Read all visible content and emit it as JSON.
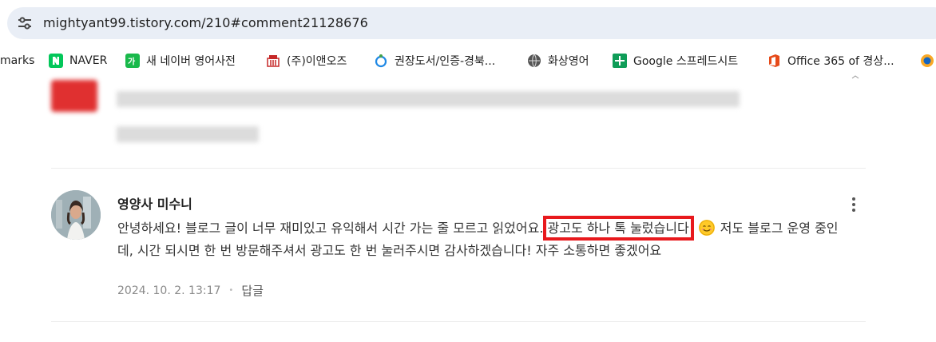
{
  "browser": {
    "url": "mightyant99.tistory.com/210#comment21128676"
  },
  "bookmarks": [
    {
      "label": "marks",
      "icon": "bookmarks-icon"
    },
    {
      "label": "NAVER",
      "icon": "naver-icon"
    },
    {
      "label": "새 네이버 영어사전",
      "icon": "naver-dictionary-icon"
    },
    {
      "label": "(주)이앤오즈",
      "icon": "eanoz-icon"
    },
    {
      "label": "권장도서/인증-경북...",
      "icon": "book-cert-icon"
    },
    {
      "label": "화상영어",
      "icon": "video-english-icon"
    },
    {
      "label": "Google 스프레드시트",
      "icon": "google-sheets-icon"
    },
    {
      "label": "Office 365 of 경상...",
      "icon": "office-icon"
    }
  ],
  "comment": {
    "author": "영양사 미수니",
    "text_before": "안녕하세요! 블로그 글이 너무 재미있고 유익해서 시간 가는 줄 모르고 읽었어요.",
    "highlight": "광고도 하나 톡 눌렀습니다",
    "text_after": " 저도 블로그 운영 중인데, 시간 되시면 한 번 방문해주셔서 광고도 한 번 눌러주시면 감사하겠습니다! 자주 소통하면 좋겠어요",
    "date": "2024. 10. 2. 13:17",
    "separator": "•",
    "reply_label": "답글",
    "emoji": "smiling-face-icon"
  },
  "colors": {
    "highlight_box": "#e8191d",
    "omnibox_bg": "#e9eef6"
  }
}
